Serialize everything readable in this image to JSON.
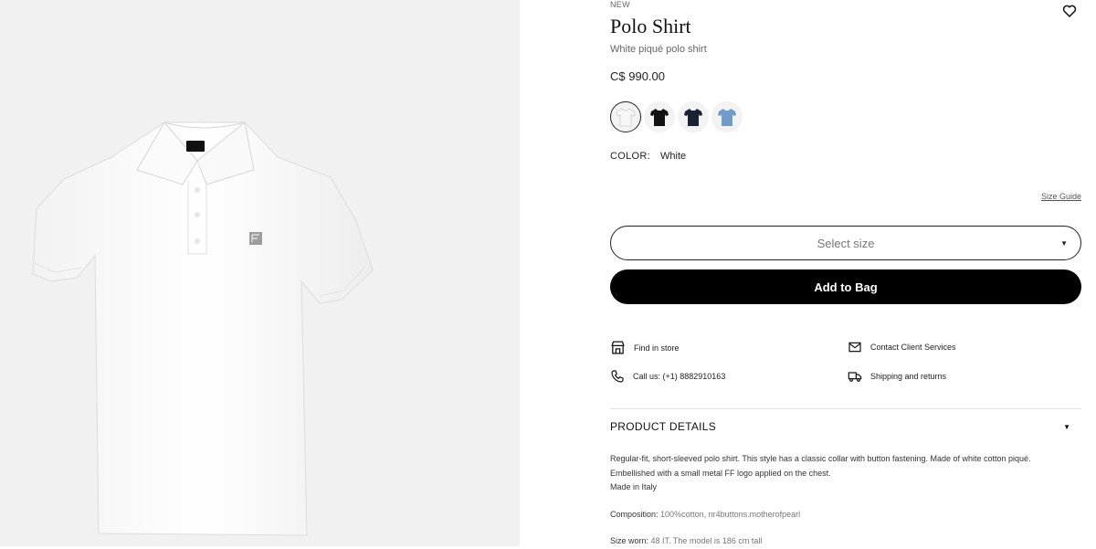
{
  "product": {
    "badge": "NEW",
    "title": "Polo Shirt",
    "subtitle": "White piqué polo shirt",
    "price": "C$ 990.00"
  },
  "colors": {
    "label": "COLOR:",
    "selected": "White",
    "swatches": [
      {
        "name": "White",
        "hex": "#f7f7f7"
      },
      {
        "name": "Black",
        "hex": "#111111"
      },
      {
        "name": "Navy",
        "hex": "#1b2233"
      },
      {
        "name": "Light Blue",
        "hex": "#6f9cc8"
      }
    ]
  },
  "size": {
    "guide_label": "Size Guide",
    "select_placeholder": "Select size"
  },
  "actions": {
    "add_to_bag": "Add to Bag"
  },
  "services": {
    "find_in_store": "Find in store",
    "contact": "Contact Client Services",
    "call": "Call us: (+1) 8882910163",
    "shipping": "Shipping and returns"
  },
  "details": {
    "heading": "PRODUCT DETAILS",
    "description_1": "Regular-fit, short-sleeved polo shirt. This style has a classic collar with button fastening. Made of white cotton piqué.",
    "description_2": "Embellished with a small metal FF logo applied on the chest.",
    "made_in": "Made in Italy",
    "composition_label": "Composition:",
    "composition_value": "100%cotton, nr4buttons.motherofpearl",
    "size_worn_label": "Size worn:",
    "size_worn_value": "48 IT. The model is 186 cm tall"
  },
  "icons": {
    "wishlist": "heart-icon",
    "find_in_store": "store-icon",
    "contact": "envelope-icon",
    "call": "phone-icon",
    "shipping": "truck-icon",
    "dropdown": "caret-down-icon"
  }
}
